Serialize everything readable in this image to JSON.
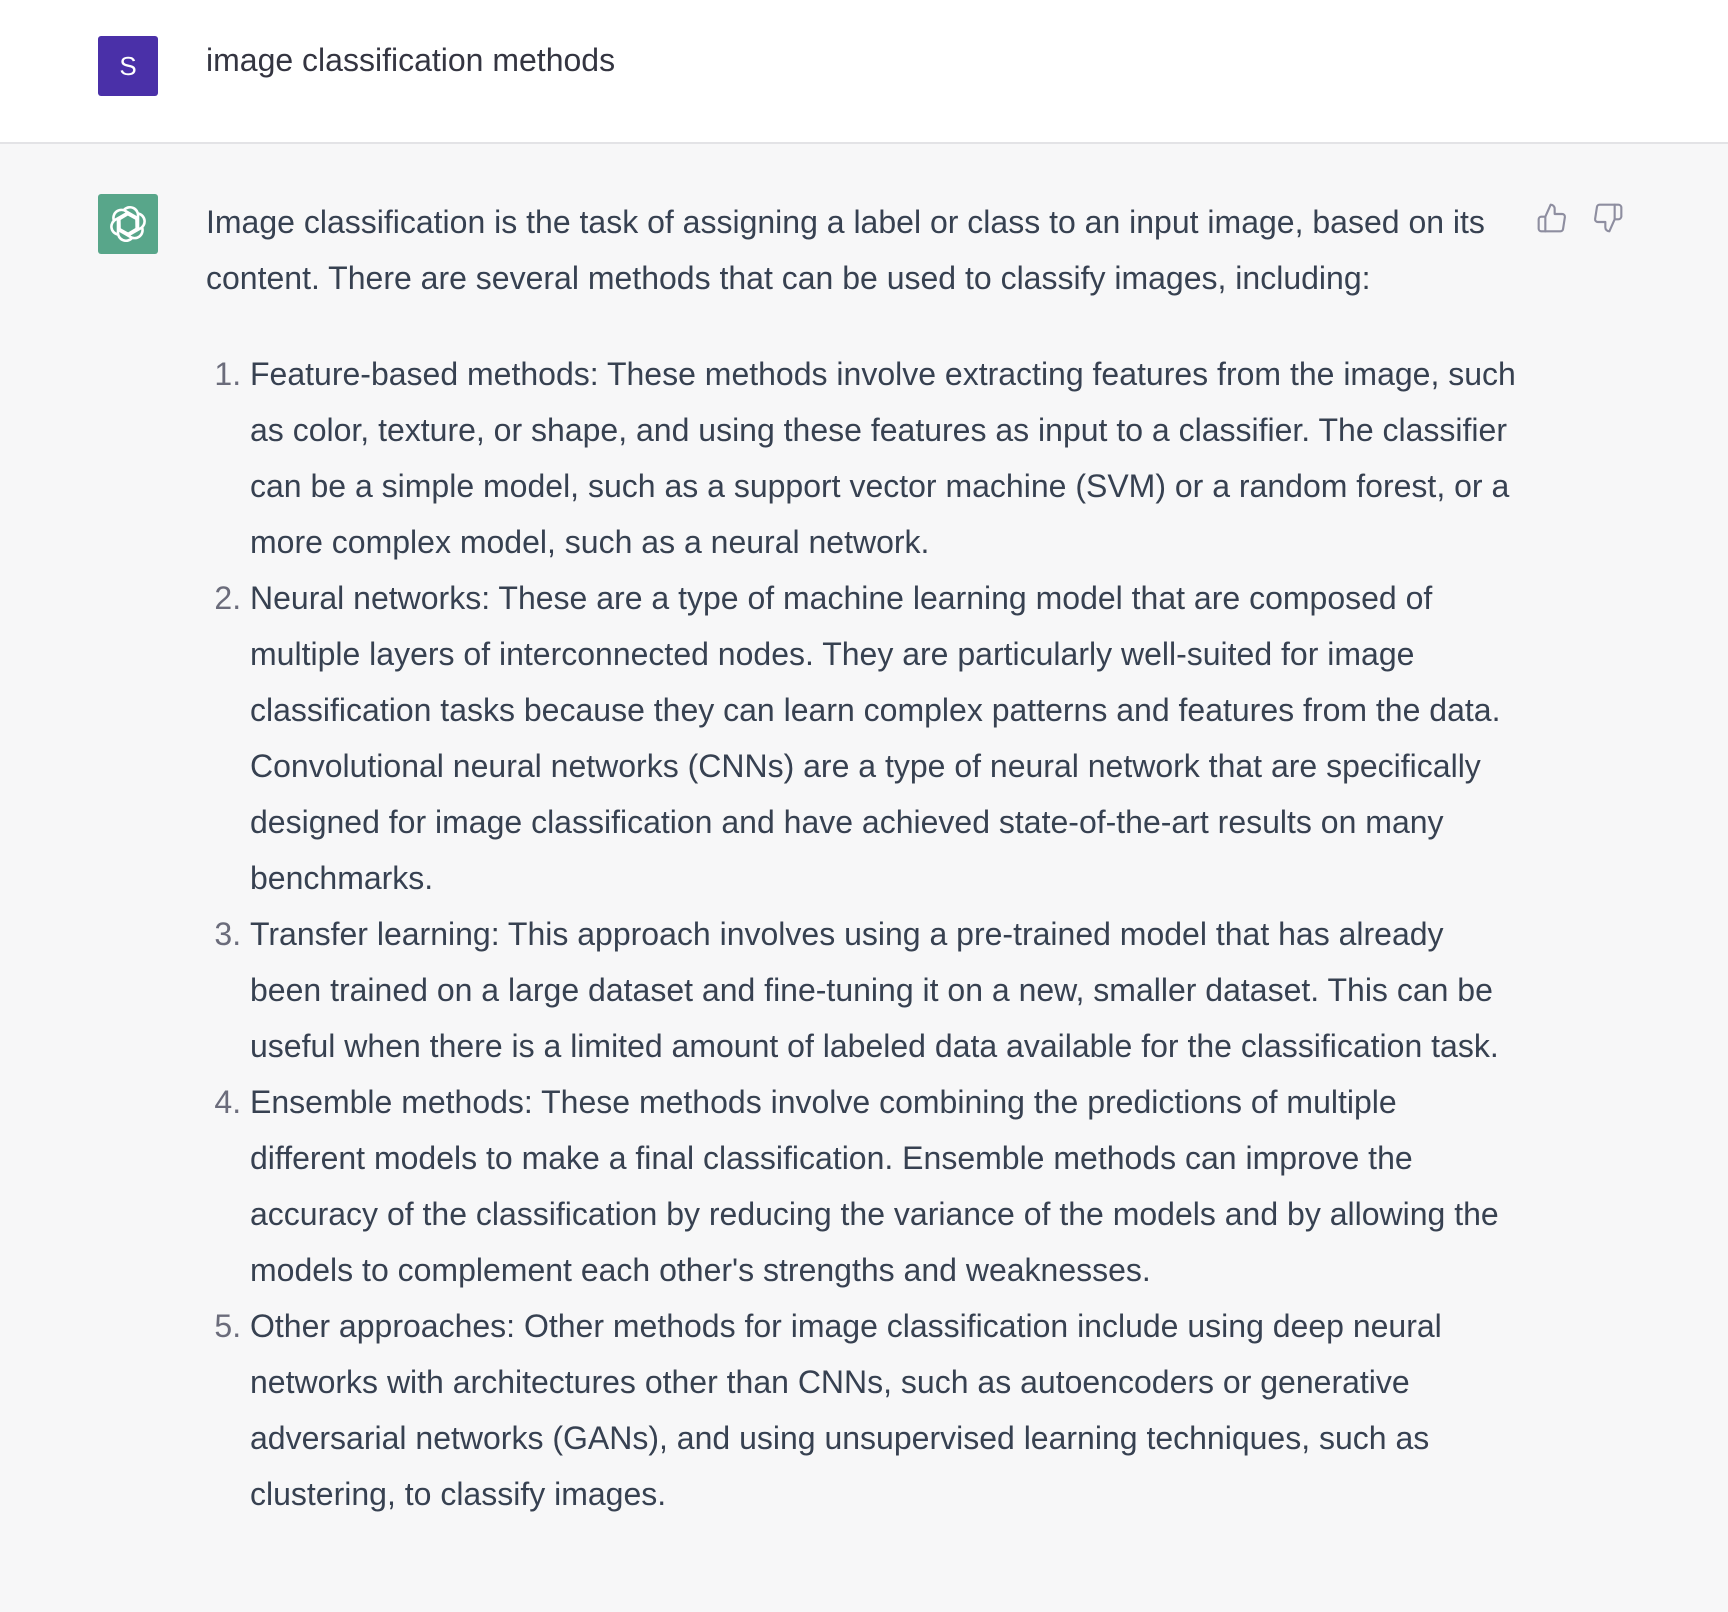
{
  "user_message": {
    "avatar_letter": "S",
    "text": "image classification methods",
    "avatar_color": "#4a30a8"
  },
  "assistant_message": {
    "avatar_icon": "openai-logo-icon",
    "avatar_color": "#58a68a",
    "intro": "Image classification is the task of assigning a label or class to an input image, based on its content. There are several methods that can be used to classify images, including:",
    "items": [
      "Feature-based methods: These methods involve extracting features from the image, such as color, texture, or shape, and using these features as input to a classifier. The classifier can be a simple model, such as a support vector machine (SVM) or a random forest, or a more complex model, such as a neural network.",
      "Neural networks: These are a type of machine learning model that are composed of multiple layers of interconnected nodes. They are particularly well-suited for image classification tasks because they can learn complex patterns and features from the data. Convolutional neural networks (CNNs) are a type of neural network that are specifically designed for image classification and have achieved state-of-the-art results on many benchmarks.",
      "Transfer learning: This approach involves using a pre-trained model that has already been trained on a large dataset and fine-tuning it on a new, smaller dataset. This can be useful when there is a limited amount of labeled data available for the classification task.",
      "Ensemble methods: These methods involve combining the predictions of multiple different models to make a final classification. Ensemble methods can improve the accuracy of the classification by reducing the variance of the models and by allowing the models to complement each other's strengths and weaknesses.",
      "Other approaches: Other methods for image classification include using deep neural networks with architectures other than CNNs, such as autoencoders or generative adversarial networks (GANs), and using unsupervised learning techniques, such as clustering, to classify images."
    ],
    "feedback_icons": [
      "thumbs-up-icon",
      "thumbs-down-icon"
    ]
  }
}
